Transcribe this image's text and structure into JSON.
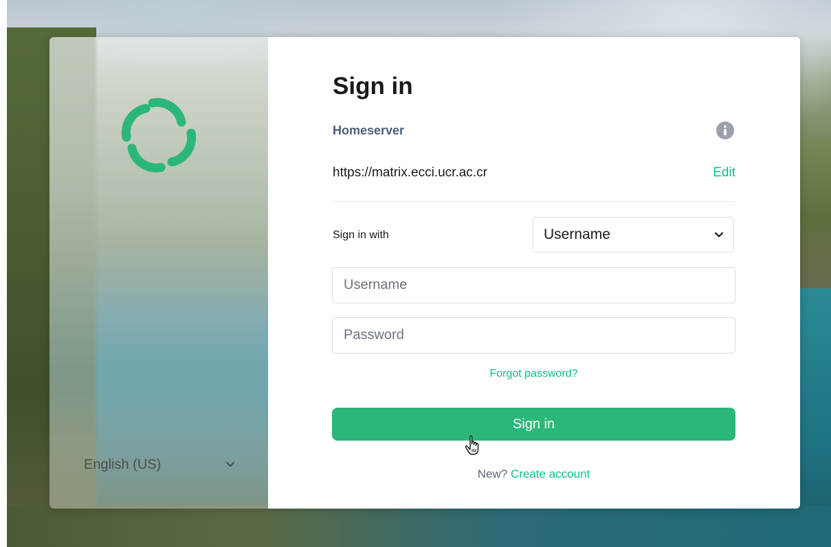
{
  "auth": {
    "title": "Sign in",
    "homeserver_label": "Homeserver",
    "homeserver_url": "https://matrix.ecci.ucr.ac.cr",
    "edit_label": "Edit",
    "sign_in_with_label": "Sign in with",
    "sign_in_with_value": "Username",
    "username_placeholder": "Username",
    "password_placeholder": "Password",
    "forgot_password": "Forgot password?",
    "sign_in_button": "Sign in",
    "new_prefix": "New?",
    "create_account": "Create account"
  },
  "language": {
    "selected": "English (US)"
  },
  "icons": {
    "logo": "element-logo-icon",
    "info": "info-icon",
    "dropdown": "chevron-down-icon",
    "cursor": "hand-pointer-icon"
  },
  "colors": {
    "accent": "#0dbd8b",
    "button": "#2bb77a",
    "title": "#17191c",
    "label": "#4e5d7a"
  }
}
